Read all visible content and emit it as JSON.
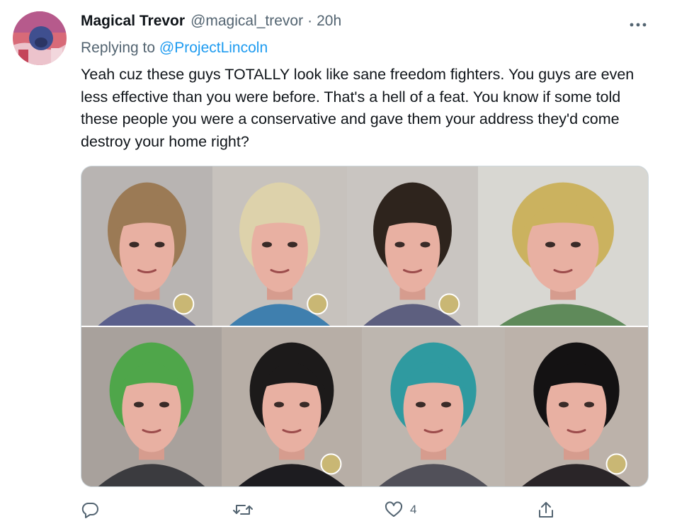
{
  "tweet": {
    "display_name": "Magical Trevor",
    "handle": "@magical_trevor",
    "separator": "·",
    "time": "20h",
    "replying_prefix": "Replying to",
    "replying_to": "@ProjectLincoln",
    "text": "Yeah cuz these guys TOTALLY look like sane freedom fighters. You guys are even less effective than you were before. That's a hell of a feat. You know if some told these people you were a conservative and gave them your address they'd come destroy your home right?",
    "more_label": "···",
    "media": {
      "tiles": [
        {
          "name": "photo-1",
          "hair": "#9b7a55",
          "shirt": "#5a5f8c",
          "bg": "#b8b4b2"
        },
        {
          "name": "photo-2",
          "hair": "#ddd2ab",
          "shirt": "#3f7fae",
          "bg": "#c7c2bd"
        },
        {
          "name": "photo-3",
          "hair": "#2e241d",
          "shirt": "#5d5f7f",
          "bg": "#c9c5c1"
        },
        {
          "name": "photo-4",
          "hair": "#cbb25f",
          "shirt": "#5f8a5a",
          "bg": "#d8d7d2"
        },
        {
          "name": "photo-5",
          "hair": "#4fa64a",
          "shirt": "#3b3b3f",
          "bg": "#a8a19c"
        },
        {
          "name": "photo-6",
          "hair": "#1c1a1a",
          "shirt": "#1d1c20",
          "bg": "#b7aea6"
        },
        {
          "name": "photo-7",
          "hair": "#2f9aa0",
          "shirt": "#515059",
          "bg": "#bdb6af"
        },
        {
          "name": "photo-8",
          "hair": "#141213",
          "shirt": "#2a2528",
          "bg": "#bcb2aa"
        }
      ]
    },
    "actions": {
      "reply_count": "",
      "retweet_count": "",
      "like_count": "4"
    }
  },
  "colors": {
    "link": "#1d9bf0",
    "secondary": "#536471",
    "text": "#0f1419"
  },
  "icons": {
    "more": "more-icon",
    "reply": "reply-icon",
    "retweet": "retweet-icon",
    "like": "heart-icon",
    "share": "share-icon"
  }
}
